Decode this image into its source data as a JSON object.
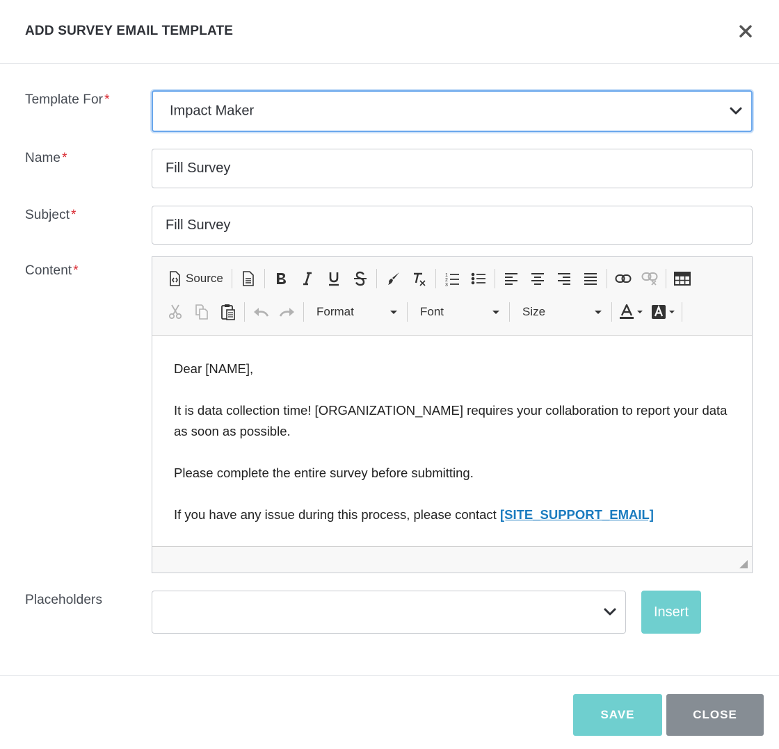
{
  "modal": {
    "title": "ADD SURVEY EMAIL TEMPLATE",
    "close_icon": "close-x-icon"
  },
  "form": {
    "template_for": {
      "label": "Template For",
      "required_mark": "*",
      "value": "Impact Maker"
    },
    "name": {
      "label": "Name",
      "required_mark": "*",
      "value": "Fill Survey"
    },
    "subject": {
      "label": "Subject",
      "required_mark": "*",
      "value": "Fill Survey"
    },
    "content": {
      "label": "Content",
      "required_mark": "*"
    },
    "placeholders": {
      "label": "Placeholders",
      "value": "",
      "insert_label": "Insert"
    }
  },
  "editor": {
    "toolbar": {
      "source_label": "Source",
      "format_label": "Format",
      "font_label": "Font",
      "size_label": "Size"
    },
    "body": {
      "greeting": "Dear [NAME],",
      "paragraph1": "It is data collection time! [ORGANIZATION_NAME] requires your collaboration to report your data as soon as possible.",
      "paragraph2": "Please complete the entire survey before submitting.",
      "paragraph3_text": "If you have any issue during this process, please contact ",
      "paragraph3_link": "[SITE_SUPPORT_EMAIL]"
    }
  },
  "footer": {
    "save_label": "SAVE",
    "close_label": "CLOSE"
  },
  "colors": {
    "accent_teal": "#6fcfcf",
    "close_gray": "#868d94",
    "required_red": "#d9262e",
    "focus_blue": "#6aa7ec",
    "link_blue": "#1a7bbf"
  }
}
